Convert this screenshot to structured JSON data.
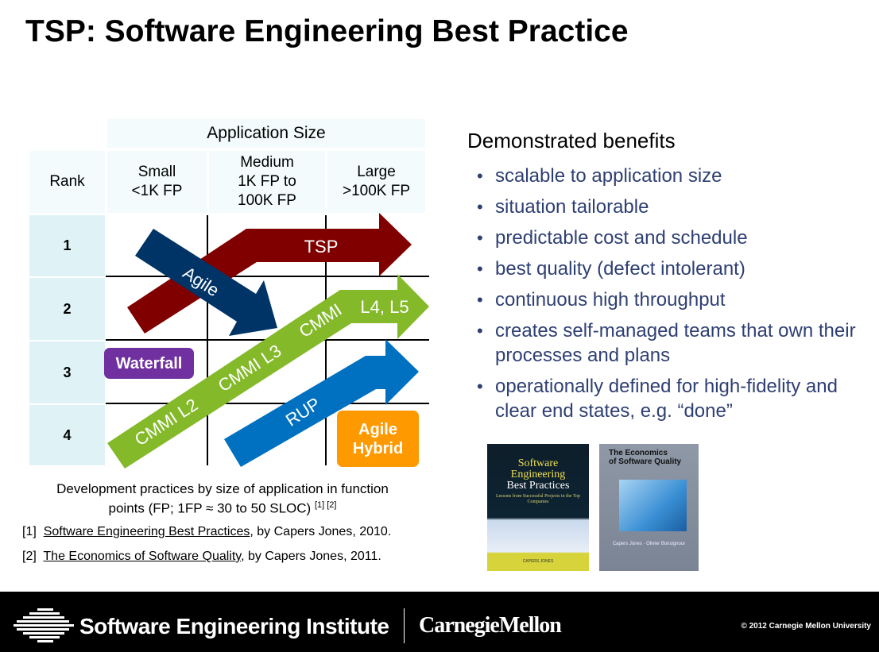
{
  "slide": {
    "title": "TSP: Software Engineering Best Practice"
  },
  "diagram": {
    "size_header": "Application Size",
    "rank_header": "Rank",
    "columns": [
      {
        "line1": "Small",
        "line2": "<1K FP",
        "line3": ""
      },
      {
        "line1": "Medium",
        "line2": "1K FP to",
        "line3": "100K FP"
      },
      {
        "line1": "Large",
        "line2": ">100K FP",
        "line3": ""
      }
    ],
    "ranks": [
      "1",
      "2",
      "3",
      "4"
    ],
    "arrows": {
      "tsp": {
        "label": "TSP",
        "color": "#800000"
      },
      "agile": {
        "label": "Agile",
        "color": "#003366"
      },
      "cmmi": {
        "labels": [
          "CMMI L2",
          "CMMI L3",
          "CMMI",
          "L4, L5"
        ],
        "color": "#84b92a"
      },
      "rup": {
        "label": "RUP",
        "color": "#0070c0"
      }
    },
    "boxes": {
      "waterfall": {
        "label": "Waterfall",
        "color": "#7030a0"
      },
      "agile_hybrid": {
        "line1": "Agile",
        "line2": "Hybrid",
        "color": "#ff9900"
      }
    },
    "caption_line1": "Development practices by size of application in function",
    "caption_line2": "points (FP; 1FP ≈ 30 to 50 SLOC)",
    "caption_refs": "[1] [2]"
  },
  "references": [
    {
      "num": "[1]",
      "title": "Software Engineering Best Practices",
      "rest": ", by Capers Jones, 2010."
    },
    {
      "num": "[2]",
      "title": "The Economics of Software Quality",
      "rest": ", by Capers Jones, 2011."
    }
  ],
  "benefits": {
    "title": "Demonstrated benefits",
    "items": [
      "scalable to application size",
      "situation tailorable",
      "predictable cost and schedule",
      "best quality (defect intolerant)",
      "continuous high throughput",
      "creates self-managed teams that own their processes and plans",
      "operationally defined for high-fidelity and clear end states, e.g. “done”"
    ]
  },
  "books": [
    {
      "title_lines": [
        "Software",
        "Engineering",
        "Best Practices"
      ],
      "subtitle": "Lessons from Successful Projects in the Top Companies",
      "author": "CAPERS JONES"
    },
    {
      "title_lines": [
        "The Economics",
        "of Software Quality"
      ],
      "author": "Capers Jones · Olivier Bonsignour"
    }
  ],
  "footer": {
    "institute": "Software Engineering Institute",
    "university": "CarnegieMellon",
    "copyright": "© 2012 Carnegie Mellon University"
  }
}
